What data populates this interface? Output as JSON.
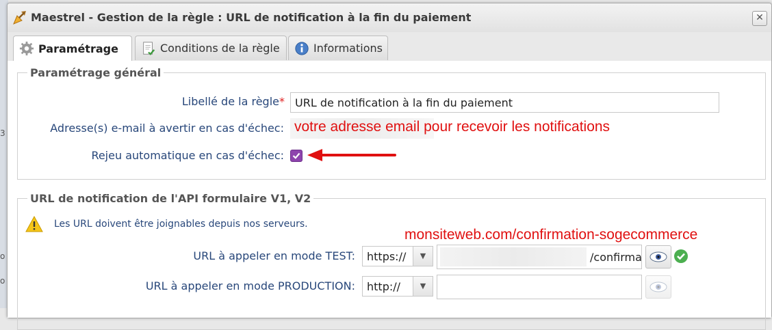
{
  "window": {
    "title": "Maestrel - Gestion de la règle : URL de notification à la fin du paiement",
    "close_label": "✕"
  },
  "tabs": [
    {
      "label": "Paramétrage",
      "icon": "gear-icon",
      "active": true
    },
    {
      "label": "Conditions de la règle",
      "icon": "document-icon",
      "active": false
    },
    {
      "label": "Informations",
      "icon": "info-icon",
      "active": false
    }
  ],
  "general": {
    "legend": "Paramétrage général",
    "rule_label": {
      "label": "Libellé de la règle",
      "required_mark": "*",
      "value": "URL de notification à la fin du paiement"
    },
    "email": {
      "label": "Adresse(s) e-mail à avertir en cas d'échec:",
      "annotation": "votre adresse email pour recevoir les notifications"
    },
    "replay": {
      "label": "Rejeu automatique en cas d'échec:",
      "checked": true
    }
  },
  "api": {
    "legend": "URL de notification de l'API formulaire V1, V2",
    "warning": "Les URL doivent être joignables depuis nos serveurs.",
    "annotation": "monsiteweb.com/confirmation-sogecommerce",
    "test": {
      "label": "URL à appeler en mode TEST:",
      "protocol": "https://",
      "url_suffix": "/confirmat"
    },
    "production": {
      "label": "URL à appeler en mode PRODUCTION:",
      "protocol": "http://",
      "url_value": ""
    }
  },
  "colors": {
    "annotation_red": "#e01010",
    "checkbox": "#8e44ad",
    "label_blue": "#28477a"
  },
  "background": {
    "fragments": [
      "3",
      "o",
      "o"
    ]
  }
}
